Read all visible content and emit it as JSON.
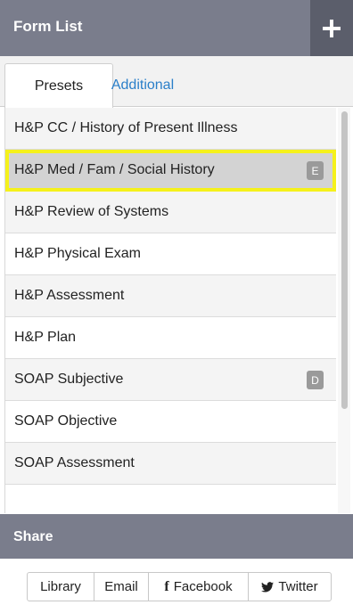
{
  "header": {
    "title": "Form List",
    "add_icon": "plus-icon"
  },
  "tabs": [
    {
      "label": "Presets",
      "active": true
    },
    {
      "label": "Additional",
      "active": false,
      "color": "#2a7fc9"
    }
  ],
  "form_list": {
    "items": [
      {
        "label": "H&P CC / History of Present Illness",
        "badge": ""
      },
      {
        "label": "H&P Med / Fam / Social History",
        "badge": "E",
        "highlighted": true
      },
      {
        "label": "H&P Review of Systems",
        "badge": ""
      },
      {
        "label": "H&P Physical Exam",
        "badge": ""
      },
      {
        "label": "H&P Assessment",
        "badge": ""
      },
      {
        "label": "H&P Plan",
        "badge": ""
      },
      {
        "label": "SOAP Subjective",
        "badge": "D"
      },
      {
        "label": "SOAP Objective",
        "badge": ""
      },
      {
        "label": "SOAP Assessment",
        "badge": ""
      },
      {
        "label": "",
        "badge": ""
      }
    ]
  },
  "share": {
    "title": "Share",
    "buttons": {
      "library": "Library",
      "email": "Email",
      "facebook": "Facebook",
      "twitter": "Twitter"
    },
    "icons": {
      "facebook": "facebook-icon",
      "twitter": "twitter-icon"
    }
  },
  "colors": {
    "header_bg": "#7a7d8c",
    "add_button_bg": "#5b5e6b",
    "highlight_outline": "#f5f11b",
    "link_blue": "#2a7fc9"
  }
}
